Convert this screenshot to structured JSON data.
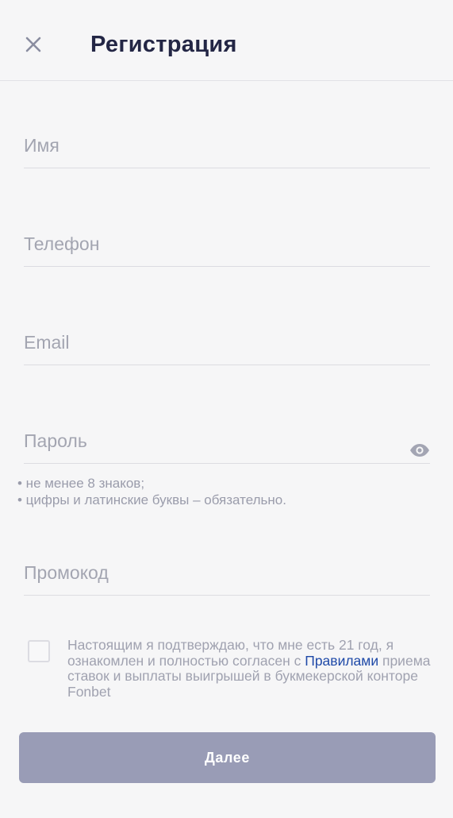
{
  "header": {
    "title": "Регистрация",
    "close_icon": "close-icon"
  },
  "form": {
    "name": {
      "placeholder": "Имя",
      "value": ""
    },
    "phone": {
      "placeholder": "Телефон",
      "value": ""
    },
    "email": {
      "placeholder": "Email",
      "value": ""
    },
    "password": {
      "placeholder": "Пароль",
      "value": "",
      "toggle_icon": "eye-icon"
    },
    "password_hints": [
      "• не менее 8 знаков;",
      "• цифры и латинские буквы – обязательно."
    ],
    "promo": {
      "placeholder": "Промокод",
      "value": ""
    }
  },
  "consent": {
    "text_before": "Настоящим я подтверждаю, что мне есть 21 год, я ознакомлен и полностью согласен с ",
    "link_text": "Правилами",
    "text_after": " приема ставок и выплаты выигрышей в букмекерской конторе Fonbet",
    "checked": false
  },
  "submit": {
    "label": "Далее"
  },
  "colors": {
    "background": "#f6f6f7",
    "title": "#232645",
    "placeholder": "#a3a5b1",
    "link": "#1f4aa8",
    "button_disabled": "#999cb6"
  }
}
